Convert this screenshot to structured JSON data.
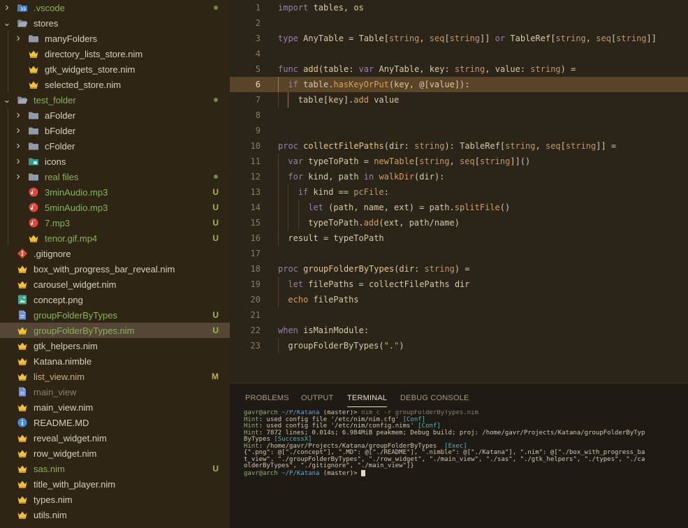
{
  "colors": {
    "sidebar_bg": "#2e2515",
    "editor_bg": "#2b2419",
    "panel_bg": "#1e1a14",
    "selected_row": "#564635",
    "active_line": "#5a4428",
    "git_untracked": "#a5b94a",
    "git_modified": "#c7ac6b"
  },
  "explorer": {
    "rows": [
      {
        "label": ".vscode",
        "icon": "vscode-folder-icon",
        "chevron": "right",
        "depth": 0,
        "status": "dot",
        "color": "#88b45a"
      },
      {
        "label": "stores",
        "icon": "folder-open-icon",
        "chevron": "down",
        "depth": 0,
        "status": "",
        "color": "#d8d0bf"
      },
      {
        "label": "manyFolders",
        "icon": "folder-icon",
        "chevron": "right",
        "depth": 1,
        "status": "",
        "color": "#d8d0bf"
      },
      {
        "label": "directory_lists_store.nim",
        "icon": "nim-crown-icon",
        "chevron": "",
        "depth": 1,
        "status": "",
        "color": "#d8d0bf"
      },
      {
        "label": "gtk_widgets_store.nim",
        "icon": "nim-crown-icon",
        "chevron": "",
        "depth": 1,
        "status": "",
        "color": "#d8d0bf"
      },
      {
        "label": "selected_store.nim",
        "icon": "nim-crown-icon",
        "chevron": "",
        "depth": 1,
        "status": "",
        "color": "#d8d0bf"
      },
      {
        "label": "test_folder",
        "icon": "folder-open-icon",
        "chevron": "down",
        "depth": 0,
        "status": "dot",
        "color": "#88b45a"
      },
      {
        "label": "aFolder",
        "icon": "folder-icon",
        "chevron": "right",
        "depth": 1,
        "status": "",
        "color": "#d8d0bf"
      },
      {
        "label": "bFolder",
        "icon": "folder-icon",
        "chevron": "right",
        "depth": 1,
        "status": "",
        "color": "#d8d0bf"
      },
      {
        "label": "cFolder",
        "icon": "folder-icon",
        "chevron": "right",
        "depth": 1,
        "status": "",
        "color": "#d8d0bf"
      },
      {
        "label": "icons",
        "icon": "icons-folder-icon",
        "chevron": "right",
        "depth": 1,
        "status": "",
        "color": "#d8d0bf"
      },
      {
        "label": "real files",
        "icon": "folder-icon",
        "chevron": "right",
        "depth": 1,
        "status": "dot",
        "color": "#88b45a"
      },
      {
        "label": "3minAudio.mp3",
        "icon": "audio-file-icon",
        "chevron": "",
        "depth": 1,
        "status": "U",
        "color": "#88b45a"
      },
      {
        "label": "5minAudio.mp3",
        "icon": "audio-file-icon",
        "chevron": "",
        "depth": 1,
        "status": "U",
        "color": "#88b45a"
      },
      {
        "label": "7.mp3",
        "icon": "audio-file-icon",
        "chevron": "",
        "depth": 1,
        "status": "U",
        "color": "#88b45a"
      },
      {
        "label": "tenor.gif.mp4",
        "icon": "nim-crown-icon",
        "chevron": "",
        "depth": 1,
        "status": "U",
        "color": "#88b45a"
      },
      {
        "label": ".gitignore",
        "icon": "git-icon",
        "chevron": "",
        "depth": 0,
        "status": "",
        "color": "#d8d0bf"
      },
      {
        "label": "box_with_progress_bar_reveal.nim",
        "icon": "nim-crown-icon",
        "chevron": "",
        "depth": 0,
        "status": "",
        "color": "#d8d0bf"
      },
      {
        "label": "carousel_widget.nim",
        "icon": "nim-crown-icon",
        "chevron": "",
        "depth": 0,
        "status": "",
        "color": "#d8d0bf"
      },
      {
        "label": "concept.png",
        "icon": "image-file-icon",
        "chevron": "",
        "depth": 0,
        "status": "",
        "color": "#d8d0bf"
      },
      {
        "label": "groupFolderByTypes",
        "icon": "file-icon",
        "chevron": "",
        "depth": 0,
        "status": "U",
        "color": "#88b45a"
      },
      {
        "label": "groupFolderByTypes.nim",
        "icon": "nim-crown-icon",
        "chevron": "",
        "depth": 0,
        "status": "U",
        "color": "#88b45a",
        "selected": true
      },
      {
        "label": "gtk_helpers.nim",
        "icon": "nim-crown-icon",
        "chevron": "",
        "depth": 0,
        "status": "",
        "color": "#d8d0bf"
      },
      {
        "label": "Katana.nimble",
        "icon": "nim-crown-icon",
        "chevron": "",
        "depth": 0,
        "status": "",
        "color": "#d8d0bf"
      },
      {
        "label": "list_view.nim",
        "icon": "nim-crown-icon",
        "chevron": "",
        "depth": 0,
        "status": "M",
        "color": "#d2b270"
      },
      {
        "label": "main_view",
        "icon": "file-icon",
        "chevron": "",
        "depth": 0,
        "status": "",
        "color": "#8a8070"
      },
      {
        "label": "main_view.nim",
        "icon": "nim-crown-icon",
        "chevron": "",
        "depth": 0,
        "status": "",
        "color": "#d8d0bf"
      },
      {
        "label": "README.MD",
        "icon": "info-icon",
        "chevron": "",
        "depth": 0,
        "status": "",
        "color": "#d8d0bf"
      },
      {
        "label": "reveal_widget.nim",
        "icon": "nim-crown-icon",
        "chevron": "",
        "depth": 0,
        "status": "",
        "color": "#d8d0bf"
      },
      {
        "label": "row_widget.nim",
        "icon": "nim-crown-icon",
        "chevron": "",
        "depth": 0,
        "status": "",
        "color": "#d8d0bf"
      },
      {
        "label": "sas.nim",
        "icon": "nim-crown-icon",
        "chevron": "",
        "depth": 0,
        "status": "U",
        "color": "#88b45a"
      },
      {
        "label": "title_with_player.nim",
        "icon": "nim-crown-icon",
        "chevron": "",
        "depth": 0,
        "status": "",
        "color": "#d8d0bf"
      },
      {
        "label": "types.nim",
        "icon": "nim-crown-icon",
        "chevron": "",
        "depth": 0,
        "status": "",
        "color": "#d8d0bf"
      },
      {
        "label": "utils.nim",
        "icon": "nim-crown-icon",
        "chevron": "",
        "depth": 0,
        "status": "",
        "color": "#d8d0bf"
      }
    ]
  },
  "editor": {
    "active_line": 6,
    "lines": [
      {
        "n": "1",
        "indent": 0,
        "tokens": [
          [
            "kw",
            "import"
          ],
          [
            "op",
            " tables, os"
          ]
        ]
      },
      {
        "n": "2",
        "indent": 0,
        "tokens": []
      },
      {
        "n": "3",
        "indent": 0,
        "tokens": [
          [
            "kw",
            "type"
          ],
          [
            "op",
            " AnyTable = Table["
          ],
          [
            "ty",
            "string"
          ],
          [
            "op",
            ", "
          ],
          [
            "ty",
            "seq"
          ],
          [
            "op",
            "["
          ],
          [
            "ty",
            "string"
          ],
          [
            "op",
            "]] "
          ],
          [
            "kw",
            "or"
          ],
          [
            "op",
            " TableRef["
          ],
          [
            "ty",
            "string"
          ],
          [
            "op",
            ", "
          ],
          [
            "ty",
            "seq"
          ],
          [
            "op",
            "["
          ],
          [
            "ty",
            "string"
          ],
          [
            "op",
            "]]"
          ]
        ]
      },
      {
        "n": "4",
        "indent": 0,
        "tokens": []
      },
      {
        "n": "5",
        "indent": 0,
        "tokens": [
          [
            "kw",
            "func"
          ],
          [
            "op",
            " "
          ],
          [
            "fn",
            "add"
          ],
          [
            "op",
            "(table: "
          ],
          [
            "kw",
            "var"
          ],
          [
            "op",
            " AnyTable, key: "
          ],
          [
            "ty",
            "string"
          ],
          [
            "op",
            ", value: "
          ],
          [
            "ty",
            "string"
          ],
          [
            "op",
            ") ="
          ]
        ]
      },
      {
        "n": "6",
        "indent": 1,
        "tokens": [
          [
            "kw",
            "if"
          ],
          [
            "op",
            " table."
          ],
          [
            "bi",
            "hasKeyOrPut"
          ],
          [
            "op",
            "(key, @[value]):"
          ]
        ]
      },
      {
        "n": "7",
        "indent": 2,
        "tokens": [
          [
            "op",
            "table[key]."
          ],
          [
            "bi",
            "add"
          ],
          [
            "op",
            " value"
          ]
        ]
      },
      {
        "n": "8",
        "indent": 0,
        "tokens": []
      },
      {
        "n": "9",
        "indent": 0,
        "tokens": []
      },
      {
        "n": "10",
        "indent": 0,
        "tokens": [
          [
            "kw",
            "proc"
          ],
          [
            "op",
            " "
          ],
          [
            "fn",
            "collectFilePaths"
          ],
          [
            "op",
            "(dir: "
          ],
          [
            "ty",
            "string"
          ],
          [
            "op",
            "): TableRef["
          ],
          [
            "ty",
            "string"
          ],
          [
            "op",
            ", "
          ],
          [
            "ty",
            "seq"
          ],
          [
            "op",
            "["
          ],
          [
            "ty",
            "string"
          ],
          [
            "op",
            "]] ="
          ]
        ]
      },
      {
        "n": "11",
        "indent": 1,
        "tokens": [
          [
            "kw",
            "var"
          ],
          [
            "op",
            " typeToPath = "
          ],
          [
            "bi",
            "newTable"
          ],
          [
            "op",
            "["
          ],
          [
            "ty",
            "string"
          ],
          [
            "op",
            ", "
          ],
          [
            "ty",
            "seq"
          ],
          [
            "op",
            "["
          ],
          [
            "ty",
            "string"
          ],
          [
            "op",
            "]]()"
          ]
        ]
      },
      {
        "n": "12",
        "indent": 1,
        "tokens": [
          [
            "kw",
            "for"
          ],
          [
            "op",
            " kind, path "
          ],
          [
            "kw",
            "in"
          ],
          [
            "op",
            " "
          ],
          [
            "bi",
            "walkDir"
          ],
          [
            "op",
            "(dir):"
          ]
        ]
      },
      {
        "n": "13",
        "indent": 2,
        "tokens": [
          [
            "kw",
            "if"
          ],
          [
            "op",
            " kind == "
          ],
          [
            "ty",
            "pcFile"
          ],
          [
            "op",
            ":"
          ]
        ]
      },
      {
        "n": "14",
        "indent": 3,
        "tokens": [
          [
            "kw",
            "let"
          ],
          [
            "op",
            " (path, name, ext) = path."
          ],
          [
            "bi",
            "splitFile"
          ],
          [
            "op",
            "()"
          ]
        ]
      },
      {
        "n": "15",
        "indent": 3,
        "tokens": [
          [
            "op",
            "typeToPath."
          ],
          [
            "bi",
            "add"
          ],
          [
            "op",
            "(ext, path/name)"
          ]
        ]
      },
      {
        "n": "16",
        "indent": 1,
        "tokens": [
          [
            "op",
            "result = typeToPath"
          ]
        ]
      },
      {
        "n": "17",
        "indent": 0,
        "tokens": []
      },
      {
        "n": "18",
        "indent": 0,
        "tokens": [
          [
            "kw",
            "proc"
          ],
          [
            "op",
            " "
          ],
          [
            "fn",
            "groupFolderByTypes"
          ],
          [
            "op",
            "(dir: "
          ],
          [
            "ty",
            "string"
          ],
          [
            "op",
            ") ="
          ]
        ]
      },
      {
        "n": "19",
        "indent": 1,
        "tokens": [
          [
            "kw",
            "let"
          ],
          [
            "op",
            " filePaths = collectFilePaths dir"
          ]
        ]
      },
      {
        "n": "20",
        "indent": 1,
        "tokens": [
          [
            "bi",
            "echo"
          ],
          [
            "op",
            " filePaths"
          ]
        ]
      },
      {
        "n": "21",
        "indent": 0,
        "tokens": []
      },
      {
        "n": "22",
        "indent": 0,
        "tokens": [
          [
            "kw",
            "when"
          ],
          [
            "op",
            " isMainModule:"
          ]
        ]
      },
      {
        "n": "23",
        "indent": 1,
        "tokens": [
          [
            "op",
            "groupFolderByTypes("
          ],
          [
            "st",
            "\".\""
          ],
          [
            "op",
            ")"
          ]
        ]
      }
    ]
  },
  "panel": {
    "tabs": [
      {
        "label": "PROBLEMS",
        "active": false
      },
      {
        "label": "OUTPUT",
        "active": false
      },
      {
        "label": "TERMINAL",
        "active": true
      },
      {
        "label": "DEBUG CONSOLE",
        "active": false
      }
    ]
  },
  "terminal": {
    "lines": [
      [
        [
          "green",
          "gavr@arch"
        ],
        [
          "plain",
          " "
        ],
        [
          "blue",
          "~/P/Katana"
        ],
        [
          "plain",
          " (master)> "
        ],
        [
          "dim",
          "nim c -r groupFolderByTypes.nim"
        ]
      ],
      [
        [
          "green",
          "Hint"
        ],
        [
          "plain",
          ": used config file '/etc/nim/nim.cfg' "
        ],
        [
          "cyan",
          "[Conf]"
        ]
      ],
      [
        [
          "green",
          "Hint"
        ],
        [
          "plain",
          ": used config file '/etc/nim/config.nims' "
        ],
        [
          "cyan",
          "[Conf]"
        ]
      ],
      [
        [
          "green",
          "Hint"
        ],
        [
          "plain",
          ": 7872 lines; 0.014s; 6.984MiB peakmem; Debug build; proj: /home/gavr/Projects/Katana/groupFolderByTyp"
        ]
      ],
      [
        [
          "plain",
          "ByTypes "
        ],
        [
          "cyan",
          "[SuccessX]"
        ]
      ],
      [
        [
          "green",
          "Hint"
        ],
        [
          "plain",
          ": /home/gavr/Projects/Katana/groupFolderByTypes  "
        ],
        [
          "cyan",
          "[Exec]"
        ]
      ],
      [
        [
          "plain",
          "{\".png\": @[\"./concept\"], \".MD\": @[\"./README\"], \".nimble\": @[\"./Katana\"], \".nim\": @[\"./box_with_progress_ba"
        ]
      ],
      [
        [
          "plain",
          "t_view\", \"./groupFolderByTypes\", \"./row_widget\", \"./main_view\", \"./sas\", \"./gtk_helpers\", \"./types\", \"./ca"
        ]
      ],
      [
        [
          "plain",
          "olderByTypes\", \"./gitignore\", \"./main_view\"]}"
        ]
      ],
      [
        [
          "green",
          "gavr@arch"
        ],
        [
          "plain",
          " "
        ],
        [
          "blue",
          "~/P/Katana"
        ],
        [
          "plain",
          " (master)> "
        ],
        [
          "cursor",
          ""
        ]
      ]
    ]
  }
}
